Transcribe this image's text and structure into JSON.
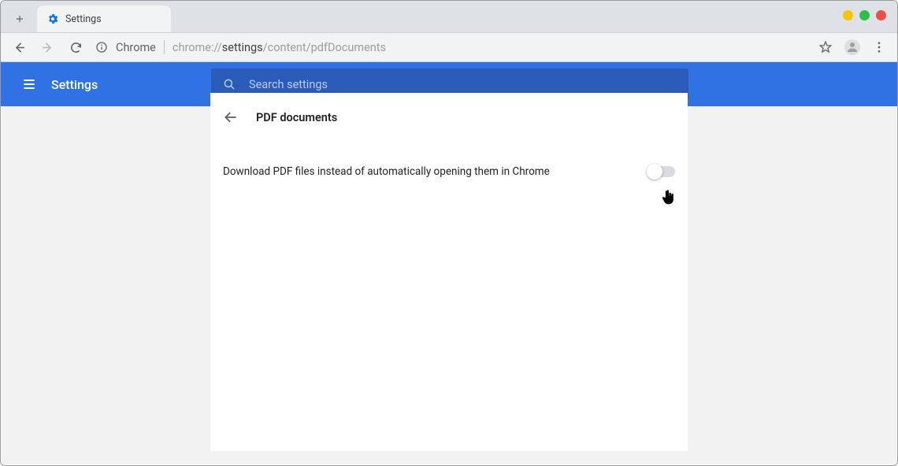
{
  "browser": {
    "tab_title": "Settings",
    "address_chip": "Chrome",
    "url_prefix": "chrome://",
    "url_bold": "settings",
    "url_suffix": "/content/pdfDocuments"
  },
  "header": {
    "app_title": "Settings",
    "search_placeholder": "Search settings"
  },
  "page": {
    "title": "PDF documents",
    "option_label": "Download PDF files instead of automatically opening them in Chrome",
    "toggle_on": false
  }
}
